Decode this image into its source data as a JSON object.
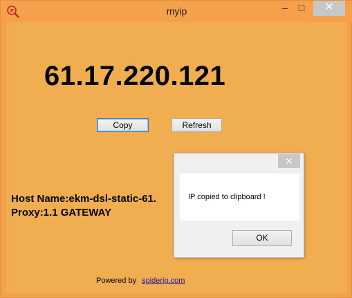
{
  "window": {
    "title": "myip",
    "app_icon": "ip-magnifier-icon",
    "minimize": "–",
    "maximize": "□",
    "close": "✕"
  },
  "main": {
    "ip_address": "61.17.220.121",
    "copy_label": "Copy",
    "refresh_label": "Refresh",
    "host_name": "Host Name:ekm-dsl-static-61.",
    "proxy": "Proxy:1.1 GATEWAY",
    "powered_by": "Powered by",
    "link_text": "spiderip.com"
  },
  "dialog": {
    "close": "✕",
    "message": "IP copied to clipboard !",
    "ok_label": "OK"
  },
  "colors": {
    "background": "#f1ae51",
    "link": "#1a0dab"
  }
}
